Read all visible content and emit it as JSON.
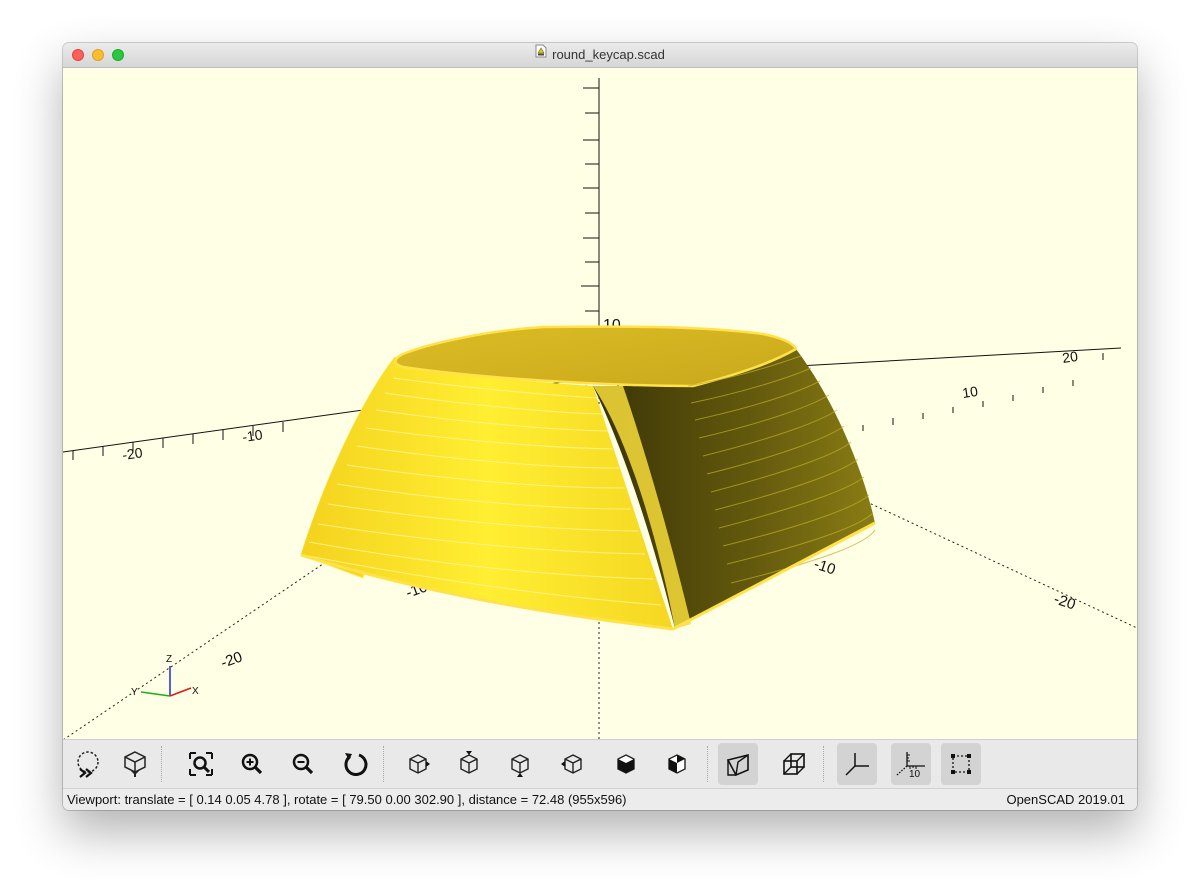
{
  "window": {
    "title": "round_keycap.scad"
  },
  "viewport": {
    "tick_labels": {
      "x_neg": "-10",
      "x_neg2": "-20",
      "y_pos": "10",
      "y_pos2": "20",
      "y_neg": "-10",
      "y_neg2": "-20",
      "z_pos": "10"
    },
    "axes_indicator": {
      "z": "Z",
      "y": "Y",
      "x": "X"
    },
    "colors": {
      "background": "#ffffe5",
      "model_light": "#ffeb2c",
      "model_dark": "#645a0c"
    }
  },
  "toolbar": {
    "buttons": [
      {
        "name": "preview-button",
        "icon": "preview-icon"
      },
      {
        "name": "render-button",
        "icon": "render-icon"
      },
      {
        "name": "view-all-button",
        "icon": "view-all-icon"
      },
      {
        "name": "zoom-in-button",
        "icon": "zoom-in-icon"
      },
      {
        "name": "zoom-out-button",
        "icon": "zoom-out-icon"
      },
      {
        "name": "reset-view-button",
        "icon": "reset-view-icon"
      },
      {
        "name": "view-right-button",
        "icon": "view-right-icon"
      },
      {
        "name": "view-top-button",
        "icon": "view-top-icon"
      },
      {
        "name": "view-bottom-button",
        "icon": "view-bottom-icon"
      },
      {
        "name": "view-left-button",
        "icon": "view-left-icon"
      },
      {
        "name": "view-front-button",
        "icon": "view-front-icon"
      },
      {
        "name": "view-back-button",
        "icon": "view-back-icon"
      },
      {
        "name": "perspective-button",
        "icon": "perspective-icon",
        "active": true
      },
      {
        "name": "orthogonal-button",
        "icon": "orthogonal-icon"
      },
      {
        "name": "show-axes-button",
        "icon": "axes-icon",
        "active": true
      },
      {
        "name": "show-scale-markers-button",
        "icon": "scale-markers-icon",
        "label": "10",
        "active": true
      },
      {
        "name": "show-edges-button",
        "icon": "edges-icon",
        "active": true
      }
    ]
  },
  "status": {
    "viewport_text": "Viewport: translate = [ 0.14 0.05 4.78 ], rotate = [ 79.50 0.00 302.90 ], distance = 72.48 (955x596)",
    "version": "OpenSCAD 2019.01"
  }
}
